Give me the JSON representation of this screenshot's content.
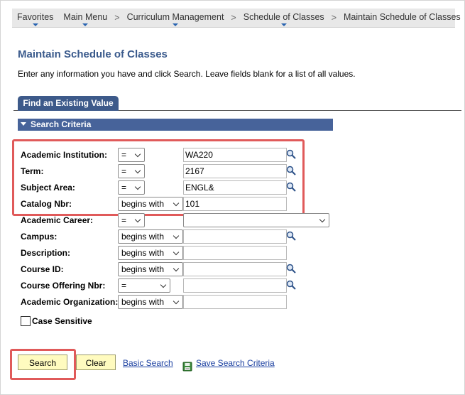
{
  "navbar": {
    "items": [
      {
        "label": "Favorites",
        "dropdown": true
      },
      {
        "label": "Main Menu",
        "dropdown": true
      },
      {
        "label": "Curriculum Management",
        "dropdown": true
      },
      {
        "label": "Schedule of Classes",
        "dropdown": true
      },
      {
        "label": "Maintain Schedule of Classes",
        "dropdown": false
      }
    ],
    "separator": ">"
  },
  "page": {
    "title": "Maintain Schedule of Classes",
    "instructions": "Enter any information you have and click Search. Leave fields blank for a list of all values."
  },
  "tab": {
    "label": "Find an Existing Value"
  },
  "section": {
    "label": "Search Criteria"
  },
  "fields": [
    {
      "label": "Academic Institution:",
      "operator": "=",
      "value": "WA220",
      "lookup": true
    },
    {
      "label": "Term:",
      "operator": "=",
      "value": "2167",
      "lookup": true
    },
    {
      "label": "Subject Area:",
      "operator": "=",
      "value": "ENGL&",
      "lookup": true
    },
    {
      "label": "Catalog Nbr:",
      "operator": "begins with",
      "value": "101",
      "lookup": false
    },
    {
      "label": "Academic Career:",
      "operator": "=",
      "value": "",
      "lookup": false
    },
    {
      "label": "Campus:",
      "operator": "begins with",
      "value": "",
      "lookup": true
    },
    {
      "label": "Description:",
      "operator": "begins with",
      "value": "",
      "lookup": false
    },
    {
      "label": "Course ID:",
      "operator": "begins with",
      "value": "",
      "lookup": true
    },
    {
      "label": "Course Offering Nbr:",
      "operator": "=",
      "value": "",
      "lookup": true
    },
    {
      "label": "Academic Organization:",
      "operator": "begins with",
      "value": "",
      "lookup": false
    }
  ],
  "case_sensitive": {
    "label": "Case Sensitive",
    "checked": false
  },
  "actions": {
    "search": "Search",
    "clear": "Clear",
    "basic_search": "Basic Search",
    "save_search": "Save Search Criteria"
  },
  "icons": {
    "lookup": "magnifier-icon",
    "save": "save-disk-icon",
    "dropdown": "triangle-down-icon"
  },
  "colors": {
    "title": "#3a5a8c",
    "tab": "#3d5a8a",
    "section_bar": "#47639a",
    "highlight": "#e05a5a",
    "button": "#fffbbf",
    "link": "#1a3fa0"
  }
}
